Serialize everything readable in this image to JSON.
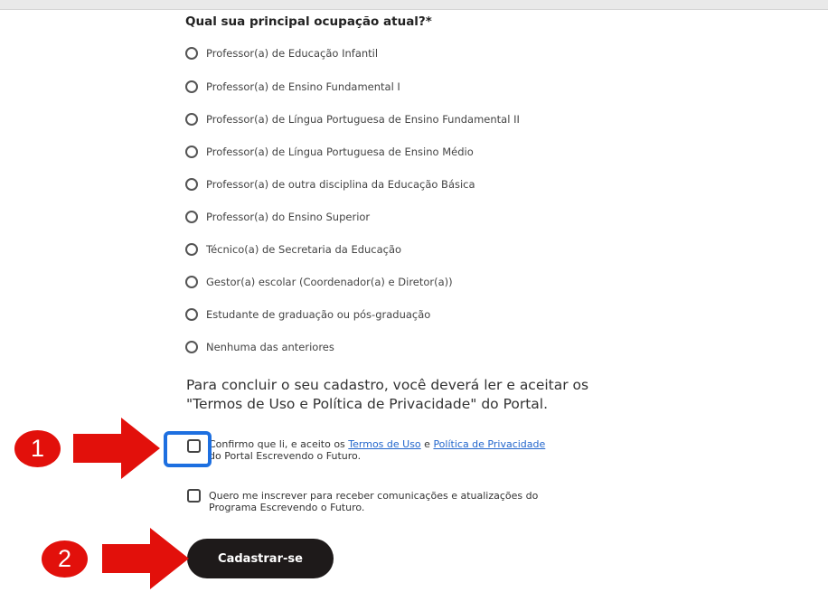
{
  "question": "Qual sua principal ocupação atual?*",
  "options": [
    "Professor(a) de Educação Infantil",
    "Professor(a) de Ensino Fundamental I",
    "Professor(a) de Língua Portuguesa de Ensino Fundamental II",
    "Professor(a) de Língua Portuguesa de Ensino Médio",
    "Professor(a) de outra disciplina da Educação Básica",
    "Professor(a) do Ensino Superior",
    "Técnico(a) de Secretaria da Educação",
    "Gestor(a) escolar (Coordenador(a) e Diretor(a))",
    "Estudante de graduação ou pós-graduação",
    "Nenhuma das anteriores"
  ],
  "terms_intro": {
    "line1": "Para concluir o seu cadastro, você deverá ler e aceitar os",
    "line2": "\"Termos de Uso e Política de Privacidade\" do Portal."
  },
  "consent": {
    "prefix": "Confirmo que li, e aceito os ",
    "terms_link": "Termos de Uso",
    "and": " e ",
    "privacy_link": "Política de Privacidade",
    "suffix": "do Portal Escrevendo o Futuro."
  },
  "newsletter": {
    "line1": "Quero me inscrever para receber comunicações e atualizações do",
    "line2": "Programa Escrevendo o Futuro."
  },
  "submit_label": "Cadastrar-se",
  "annotations": {
    "step1": "1",
    "step2": "2",
    "accent_color": "#e2100b",
    "highlight_color": "#1d6fe0"
  }
}
